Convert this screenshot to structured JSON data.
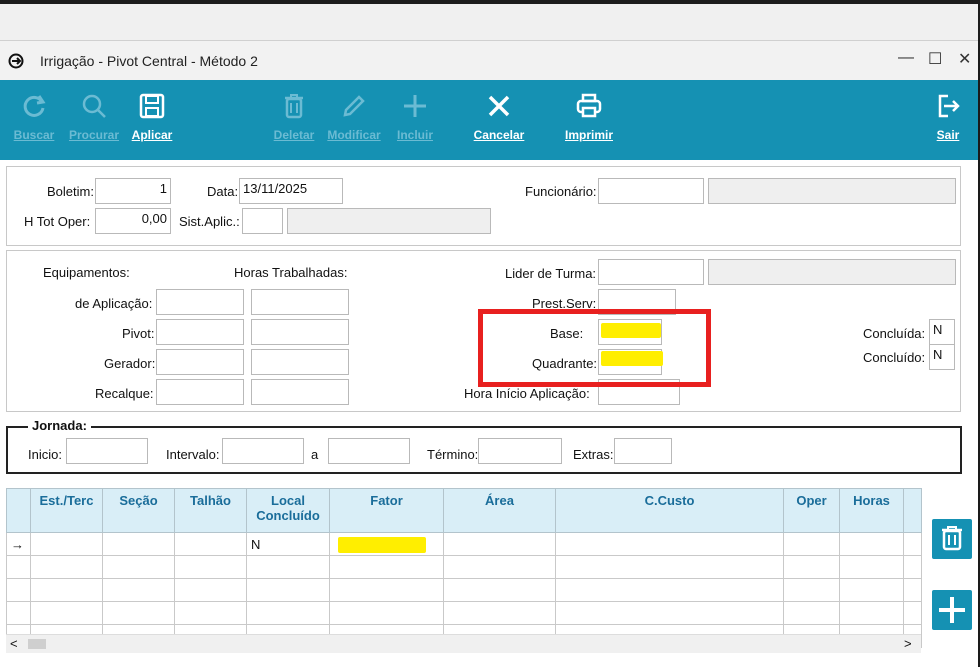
{
  "window": {
    "title": "Irrigação - Pivot Central - Método 2",
    "minimize": "—",
    "maximize": "☐",
    "close": "✕"
  },
  "toolbar": {
    "buscar": "Buscar",
    "procurar": "Procurar",
    "aplicar": "Aplicar",
    "deletar": "Deletar",
    "modificar": "Modificar",
    "incluir": "Incluir",
    "cancelar": "Cancelar",
    "imprimir": "Imprimir",
    "sair": "Sair"
  },
  "header": {
    "boletim_label": "Boletim:",
    "boletim_value": "1",
    "data_label": "Data:",
    "data_value": "13/11/2025",
    "funcionario_label": "Funcionário:",
    "htot_label": "H Tot Oper:",
    "htot_value": "0,00",
    "sistaplic_label": "Sist.Aplic.:"
  },
  "equip": {
    "equipamentos_label": "Equipamentos:",
    "horas_label": "Horas Trabalhadas:",
    "aplicacao_label": "de Aplicação:",
    "pivot_label": "Pivot:",
    "gerador_label": "Gerador:",
    "recalque_label": "Recalque:",
    "lider_label": "Lider de Turma:",
    "prest_label": "Prest.Serv:",
    "base_label": "Base:",
    "quadrante_label": "Quadrante:",
    "hora_inicio_label": "Hora Início Aplicação:",
    "concluida_label": "Concluída:",
    "concluida_value": "N",
    "concluido_label": "Concluído:",
    "concluido_value": "N"
  },
  "jornada": {
    "title": "Jornada:",
    "inicio_label": "Inicio:",
    "intervalo_label": "Intervalo:",
    "a_label": "a",
    "termino_label": "Término:",
    "extras_label": "Extras:"
  },
  "grid": {
    "columns": [
      "Est./Terc",
      "Seção",
      "Talhão",
      "Local Concluído",
      "Fator",
      "Área",
      "C.Custo",
      "Oper",
      "Horas"
    ],
    "row_marker": "→",
    "first_row_local": "N"
  },
  "scroll": {
    "left": "<",
    "right": ">"
  },
  "colors": {
    "toolbar": "#1591b3",
    "highlight": "#ffee00",
    "annotation": "#e8201f"
  }
}
